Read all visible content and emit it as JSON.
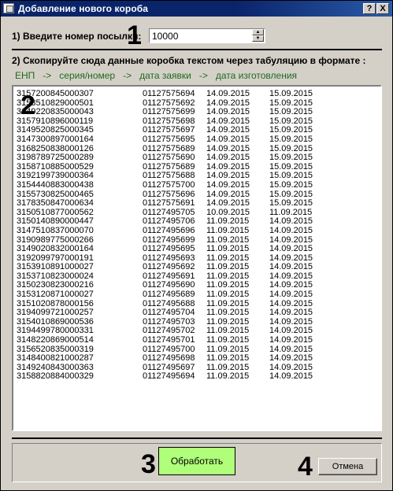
{
  "window": {
    "title": "Добавление нового короба",
    "help_button": "?",
    "close_button": "X"
  },
  "step1": {
    "label": "1) Введите номер посылки:",
    "value": "10000",
    "marker": "1"
  },
  "step2": {
    "label": "2) Скопируйте сюда данные коробка текстом через табуляцию в формате :",
    "format_hint": "ЕНП   ->   серия/номер   ->   дата заявки   ->   дата изготовления",
    "marker": "2",
    "rows": [
      [
        "3157200845000307",
        "01127575694",
        "14.09.2015",
        "15.09.2015"
      ],
      [
        "3153510829000501",
        "01127575692",
        "14.09.2015",
        "15.09.2015"
      ],
      [
        "3149220835000043",
        "01127575699",
        "14.09.2015",
        "15.09.2015"
      ],
      [
        "3157910896000119",
        "01127575698",
        "14.09.2015",
        "15.09.2015"
      ],
      [
        "3149520825000345",
        "01127575697",
        "14.09.2015",
        "15.09.2015"
      ],
      [
        "3147300897000164",
        "01127575695",
        "14.09.2015",
        "15.09.2015"
      ],
      [
        "3168250838000126",
        "01127575689",
        "14.09.2015",
        "15.09.2015"
      ],
      [
        "3198789725000289",
        "01127575690",
        "14.09.2015",
        "15.09.2015"
      ],
      [
        "3158710885000529",
        "01127575689",
        "14.09.2015",
        "15.09.2015"
      ],
      [
        "3192199739000364",
        "01127575688",
        "14.09.2015",
        "15.09.2015"
      ],
      [
        "3154440883000438",
        "01127575700",
        "14.09.2015",
        "15.09.2015"
      ],
      [
        "3155730825000465",
        "01127575696",
        "14.09.2015",
        "15.09.2015"
      ],
      [
        "3178350847000634",
        "01127575691",
        "14.09.2015",
        "15.09.2015"
      ],
      [
        "3150510877000562",
        "01127495705",
        "10.09.2015",
        "11.09.2015"
      ],
      [
        "3150140890000447",
        "01127495706",
        "11.09.2015",
        "14.09.2015"
      ],
      [
        "3147510837000070",
        "01127495696",
        "11.09.2015",
        "14.09.2015"
      ],
      [
        "3190989775000266",
        "01127495699",
        "11.09.2015",
        "14.09.2015"
      ],
      [
        "3149020832000164",
        "01127495695",
        "11.09.2015",
        "14.09.2015"
      ],
      [
        "3192099797000191",
        "01127495693",
        "11.09.2015",
        "14.09.2015"
      ],
      [
        "3153910891000027",
        "01127495692",
        "11.09.2015",
        "14.09.2015"
      ],
      [
        "3153710823000024",
        "01127495691",
        "11.09.2015",
        "14.09.2015"
      ],
      [
        "3150230823000216",
        "01127495690",
        "11.09.2015",
        "14.09.2015"
      ],
      [
        "3153120871000027",
        "01127495689",
        "11.09.2015",
        "14.09.2015"
      ],
      [
        "3151020878000156",
        "01127495688",
        "11.09.2015",
        "14.09.2015"
      ],
      [
        "3194099721000257",
        "01127495704",
        "11.09.2015",
        "14.09.2015"
      ],
      [
        "3154010869000536",
        "01127495703",
        "11.09.2015",
        "14.09.2015"
      ],
      [
        "3194499780000331",
        "01127495702",
        "11.09.2015",
        "14.09.2015"
      ],
      [
        "3148220869000514",
        "01127495701",
        "11.09.2015",
        "14.09.2015"
      ],
      [
        "3156520835000319",
        "01127495700",
        "11.09.2015",
        "14.09.2015"
      ],
      [
        "3148400821000287",
        "01127495698",
        "11.09.2015",
        "14.09.2015"
      ],
      [
        "3149240843000363",
        "01127495697",
        "11.09.2015",
        "14.09.2015"
      ],
      [
        "3158820884000329",
        "01127495694",
        "11.09.2015",
        "14.09.2015"
      ]
    ]
  },
  "actions": {
    "process_label": "Обработать",
    "process_marker": "3",
    "process_color": "#b0ff7a",
    "cancel_label": "Отмена",
    "cancel_marker": "4"
  }
}
